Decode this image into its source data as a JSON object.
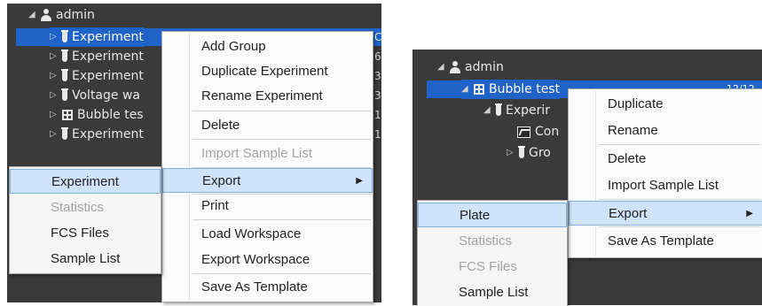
{
  "left": {
    "tree": {
      "root_label": "admin",
      "rows": [
        {
          "label": "Experiment",
          "icon": "tube-icon",
          "num": "C"
        },
        {
          "label": "Experiment",
          "icon": "tube-icon",
          "num": "6"
        },
        {
          "label": "Experiment",
          "icon": "tube-icon",
          "num": "3"
        },
        {
          "label": "Voltage wa",
          "icon": "tube-icon",
          "num": "3"
        },
        {
          "label": "Bubble tes",
          "icon": "plate-icon",
          "num": "1"
        },
        {
          "label": "Experiment",
          "icon": "tube-icon",
          "num": "1"
        }
      ]
    },
    "context_menu": {
      "items": [
        {
          "label": "Add Group",
          "disabled": false
        },
        {
          "label": "Duplicate Experiment",
          "disabled": false
        },
        {
          "label": "Rename Experiment",
          "disabled": false
        },
        {
          "label": "Delete",
          "disabled": false
        },
        {
          "label": "Import Sample List",
          "disabled": true
        },
        {
          "label": "Export",
          "disabled": false,
          "highlighted": true,
          "has_submenu": true
        },
        {
          "label": "Print",
          "disabled": false
        },
        {
          "label": "Load Workspace",
          "disabled": false
        },
        {
          "label": "Export Workspace",
          "disabled": false
        },
        {
          "label": "Save As Template",
          "disabled": false
        }
      ]
    },
    "export_submenu": {
      "items": [
        {
          "label": "Experiment",
          "disabled": false,
          "highlighted": true
        },
        {
          "label": "Statistics",
          "disabled": true
        },
        {
          "label": "FCS Files",
          "disabled": false
        },
        {
          "label": "Sample List",
          "disabled": false
        }
      ]
    }
  },
  "right": {
    "tree": {
      "root_label": "admin",
      "rows": [
        {
          "label": "Bubble test",
          "icon": "plate-icon",
          "num": "12/12"
        },
        {
          "label": "Experir",
          "icon": "tube-icon"
        },
        {
          "label": "Con",
          "icon": "chart-icon"
        },
        {
          "label": "Gro",
          "icon": "tube-icon"
        }
      ]
    },
    "context_menu": {
      "items": [
        {
          "label": "Duplicate",
          "disabled": false
        },
        {
          "label": "Rename",
          "disabled": false
        },
        {
          "label": "Delete",
          "disabled": false
        },
        {
          "label": "Import Sample List",
          "disabled": false
        },
        {
          "label": "Export",
          "disabled": false,
          "highlighted": true,
          "has_submenu": true
        },
        {
          "label": "Save As Template",
          "disabled": false
        }
      ]
    },
    "export_submenu": {
      "items": [
        {
          "label": "Plate",
          "disabled": false,
          "highlighted": true
        },
        {
          "label": "Statistics",
          "disabled": true
        },
        {
          "label": "FCS Files",
          "disabled": true
        },
        {
          "label": "Sample List",
          "disabled": false
        }
      ]
    }
  },
  "colors": {
    "tree_bg": "#3a3a3a",
    "selection": "#1f63c9",
    "menu_highlight": "#cfe3fb"
  }
}
